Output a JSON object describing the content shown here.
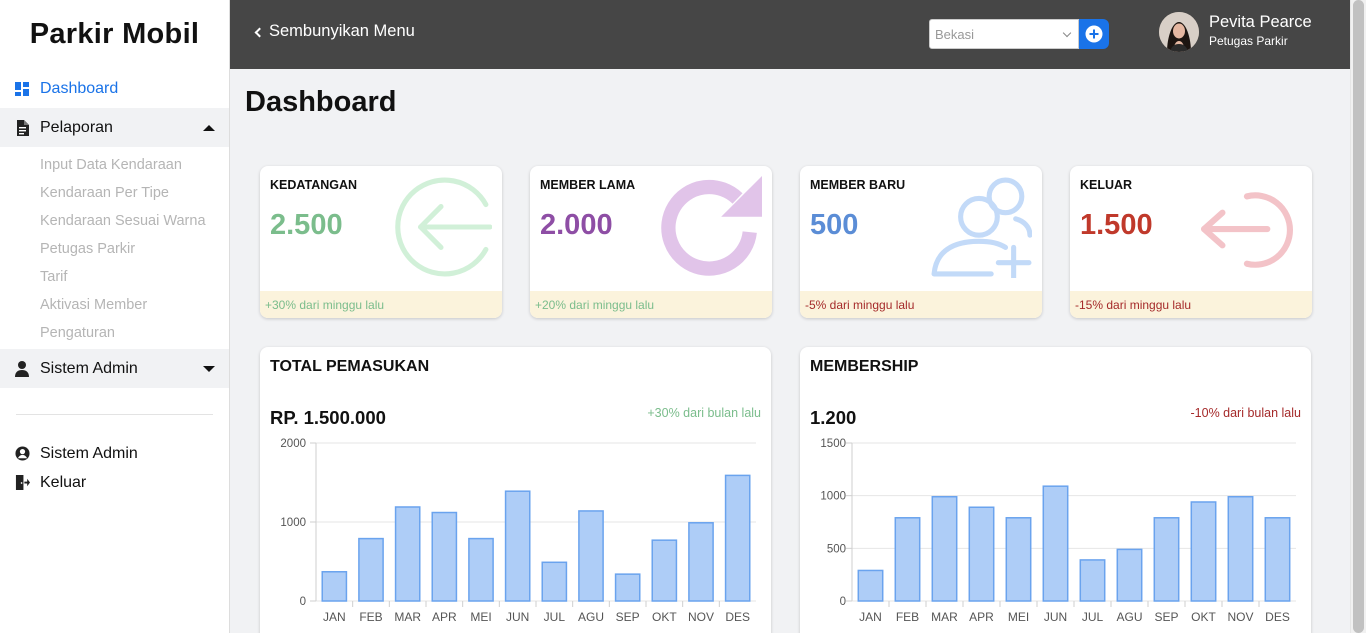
{
  "sidebar": {
    "brand": "Parkir Mobil",
    "nav": {
      "dashboard": "Dashboard",
      "pelaporan": "Pelaporan",
      "sistem_admin": "Sistem Admin"
    },
    "pelaporan_items": [
      "Input Data Kendaraan",
      "Kendaraan Per Tipe",
      "Kendaraan Sesuai Warna",
      "Petugas Parkir",
      "Tarif",
      "Aktivasi Member",
      "Pengaturan"
    ],
    "bottom": {
      "sistem_admin": "Sistem Admin",
      "keluar": "Keluar"
    }
  },
  "header": {
    "toggle_label": "Sembunyikan Menu",
    "city_select": {
      "selected": "Bekasi"
    },
    "user": {
      "name": "Pevita Pearce",
      "role": "Petugas Parkir"
    }
  },
  "page": {
    "title": "Dashboard"
  },
  "stats": [
    {
      "label": "KEDATANGAN",
      "value": "2.500",
      "change": "+30% dari minggu lalu",
      "color": "#7bbd8c",
      "change_color": "#7bbd8c",
      "icon": "arrow-left-circle-icon"
    },
    {
      "label": "MEMBER LAMA",
      "value": "2.000",
      "change": "+20% dari minggu lalu",
      "color": "#8e4ea5",
      "change_color": "#7bbd8c",
      "icon": "refresh-icon"
    },
    {
      "label": "MEMBER BARU",
      "value": "500",
      "change": "-5% dari minggu lalu",
      "color": "#5b8dd6",
      "change_color": "#a52a2a",
      "icon": "user-plus-icon"
    },
    {
      "label": "KELUAR",
      "value": "1.500",
      "change": "-15% dari minggu lalu",
      "color": "#c0392b",
      "change_color": "#a52a2a",
      "icon": "logout-icon"
    }
  ],
  "charts": {
    "pemasukan": {
      "title": "TOTAL PEMASUKAN",
      "total": "RP. 1.500.000",
      "change": "+30% dari bulan lalu",
      "change_color": "#7bbd8c"
    },
    "membership": {
      "title": "MEMBERSHIP",
      "total": "1.200",
      "change": "-10% dari bulan lalu",
      "change_color": "#a52a2a"
    }
  },
  "chart_data": [
    {
      "type": "bar",
      "categories": [
        "JAN",
        "FEB",
        "MAR",
        "APR",
        "MEI",
        "JUN",
        "JUL",
        "AGU",
        "SEP",
        "OKT",
        "NOV",
        "DES"
      ],
      "values": [
        370,
        790,
        1190,
        1120,
        790,
        1390,
        490,
        1140,
        340,
        770,
        990,
        1590
      ],
      "yticks": [
        0,
        1000,
        2000
      ],
      "ylim": [
        0,
        2000
      ],
      "bar_color": "#aecdf7",
      "bar_border": "#6aa3ee"
    },
    {
      "type": "bar",
      "categories": [
        "JAN",
        "FEB",
        "MAR",
        "APR",
        "MEI",
        "JUN",
        "JUL",
        "AGU",
        "SEP",
        "OKT",
        "NOV",
        "DES"
      ],
      "values": [
        290,
        790,
        990,
        890,
        790,
        1090,
        390,
        490,
        790,
        940,
        990,
        790
      ],
      "yticks": [
        0,
        500,
        1000,
        1500
      ],
      "ylim": [
        0,
        1500
      ],
      "bar_color": "#aecdf7",
      "bar_border": "#6aa3ee"
    }
  ]
}
